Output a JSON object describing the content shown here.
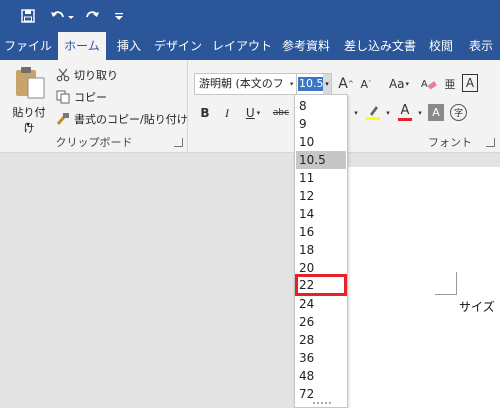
{
  "quick_access": {
    "save_icon": "save-icon",
    "undo_icon": "undo-icon",
    "redo_icon": "redo-icon",
    "customize_icon": "customize-icon"
  },
  "tabs": [
    {
      "label": "ファイル",
      "active": false
    },
    {
      "label": "ホーム",
      "active": true
    },
    {
      "label": "挿入",
      "active": false
    },
    {
      "label": "デザイン",
      "active": false
    },
    {
      "label": "レイアウト",
      "active": false
    },
    {
      "label": "参考資料",
      "active": false
    },
    {
      "label": "差し込み文書",
      "active": false
    },
    {
      "label": "校閲",
      "active": false
    },
    {
      "label": "表示",
      "active": false
    }
  ],
  "clipboard": {
    "paste_label": "貼り付け",
    "cut_label": "切り取り",
    "copy_label": "コピー",
    "format_painter_label": "書式のコピー/貼り付け",
    "group_label": "クリップボード"
  },
  "font": {
    "name": "游明朝 (本文のフ",
    "size": "10.5",
    "grow_label": "A",
    "shrink_label": "A",
    "case_label": "Aa",
    "bold": "B",
    "italic": "I",
    "underline": "U",
    "strike": "abc",
    "phonetic_label": "亜",
    "border_label": "A",
    "color_label": "A",
    "shade_label": "A",
    "enclose_label": "字",
    "group_label": "フォント",
    "colors": {
      "highlight": "#ffff00",
      "font_color": "#e8202a"
    }
  },
  "size_dropdown": {
    "options": [
      "8",
      "9",
      "10",
      "10.5",
      "11",
      "12",
      "14",
      "16",
      "18",
      "20",
      "22",
      "24",
      "26",
      "28",
      "36",
      "48",
      "72"
    ],
    "selected": "10.5",
    "highlighted": "22"
  },
  "document": {
    "text": "サイズ"
  },
  "colors": {
    "ribbon_blue": "#2b579a",
    "highlight_box": "#e8202a"
  }
}
